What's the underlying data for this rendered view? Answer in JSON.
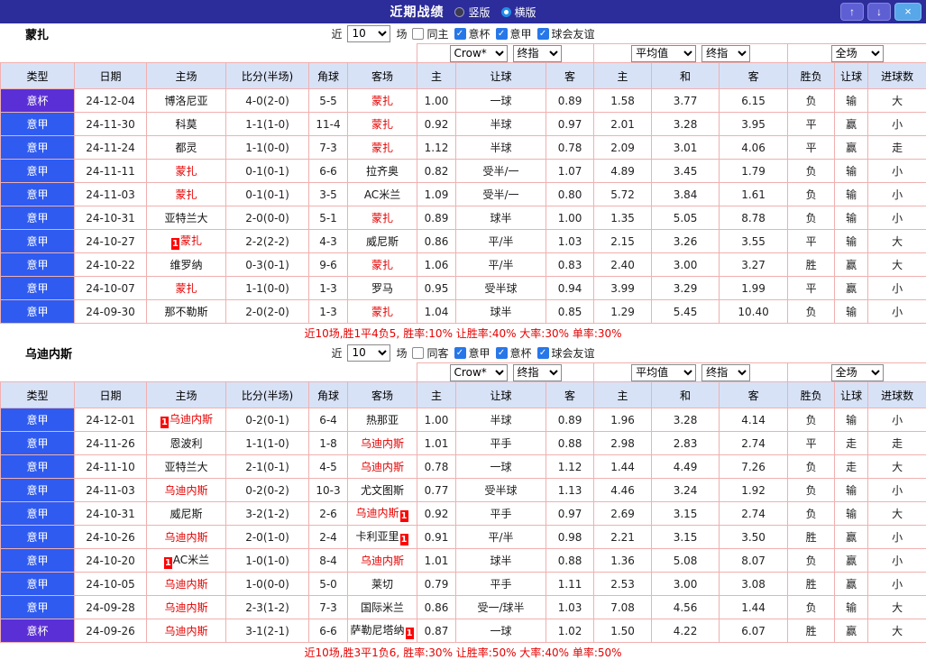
{
  "topbar": {
    "title": "近期战绩",
    "radio_vertical": "竖版",
    "radio_horizontal": "横版",
    "selected": "横版",
    "up_icon": "↑",
    "down_icon": "↓",
    "close_icon": "×"
  },
  "colors": {
    "topbar_bg": "#2c2c9a",
    "seriea_bg": "#2f5bf0",
    "cup_bg": "#5b2fd6",
    "win_red": "#e60000",
    "draw_green": "#009944",
    "lose_blue": "#2143de",
    "grid_line": "#f0b0b0",
    "header_bg": "#d8e2f6"
  },
  "table_headers": [
    "类型",
    "日期",
    "主场",
    "比分(半场)",
    "角球",
    "客场",
    "主",
    "让球",
    "客",
    "主",
    "和",
    "客",
    "胜负",
    "让球",
    "进球数"
  ],
  "sections": [
    {
      "team": "蒙扎",
      "near_label": "近",
      "near_count": "10",
      "games_label": "场",
      "checkboxes": [
        {
          "label": "同主",
          "checked": false
        },
        {
          "label": "意杯",
          "checked": true
        },
        {
          "label": "意甲",
          "checked": true
        },
        {
          "label": "球会友谊",
          "checked": true
        }
      ],
      "selects": {
        "bookmaker": "Crow*",
        "bookmaker_stat": "终指",
        "euro": "平均值",
        "euro_stat": "终指",
        "scope": "全场"
      },
      "rows": [
        {
          "lg": "c",
          "league": "意杯",
          "date": "24-12-04",
          "home": "博洛尼亚",
          "home_self": false,
          "home_card": "",
          "score": "4-0(2-0)",
          "corners": "5-5",
          "away": "蒙扎",
          "away_self": true,
          "away_card": "",
          "odds": [
            "1.00",
            "一球",
            "0.89"
          ],
          "euro": [
            "1.58",
            "3.77",
            "6.15"
          ],
          "wdl": "负",
          "wdl_c": "b",
          "hcp": "输",
          "hcp_c": "b",
          "ou": "大",
          "ou_c": "r"
        },
        {
          "lg": "a",
          "league": "意甲",
          "date": "24-11-30",
          "home": "科莫",
          "home_self": false,
          "home_card": "",
          "score": "1-1(1-0)",
          "corners": "11-4",
          "away": "蒙扎",
          "away_self": true,
          "away_card": "",
          "odds": [
            "0.92",
            "半球",
            "0.97"
          ],
          "euro": [
            "2.01",
            "3.28",
            "3.95"
          ],
          "wdl": "平",
          "wdl_c": "g",
          "hcp": "赢",
          "hcp_c": "r",
          "ou": "小",
          "ou_c": "b"
        },
        {
          "lg": "a",
          "league": "意甲",
          "date": "24-11-24",
          "home": "都灵",
          "home_self": false,
          "home_card": "",
          "score": "1-1(0-0)",
          "corners": "7-3",
          "away": "蒙扎",
          "away_self": true,
          "away_card": "",
          "odds": [
            "1.12",
            "半球",
            "0.78"
          ],
          "euro": [
            "2.09",
            "3.01",
            "4.06"
          ],
          "wdl": "平",
          "wdl_c": "g",
          "hcp": "赢",
          "hcp_c": "r",
          "ou": "走",
          "ou_c": "g"
        },
        {
          "lg": "a",
          "league": "意甲",
          "date": "24-11-11",
          "home": "蒙扎",
          "home_self": true,
          "home_card": "",
          "score": "0-1(0-1)",
          "corners": "6-6",
          "away": "拉齐奥",
          "away_self": false,
          "away_card": "",
          "odds": [
            "0.82",
            "受半/一",
            "1.07"
          ],
          "euro": [
            "4.89",
            "3.45",
            "1.79"
          ],
          "wdl": "负",
          "wdl_c": "b",
          "hcp": "输",
          "hcp_c": "b",
          "ou": "小",
          "ou_c": "b"
        },
        {
          "lg": "a",
          "league": "意甲",
          "date": "24-11-03",
          "home": "蒙扎",
          "home_self": true,
          "home_card": "",
          "score": "0-1(0-1)",
          "corners": "3-5",
          "away": "AC米兰",
          "away_self": false,
          "away_card": "",
          "odds": [
            "1.09",
            "受半/一",
            "0.80"
          ],
          "euro": [
            "5.72",
            "3.84",
            "1.61"
          ],
          "wdl": "负",
          "wdl_c": "b",
          "hcp": "输",
          "hcp_c": "b",
          "ou": "小",
          "ou_c": "b"
        },
        {
          "lg": "a",
          "league": "意甲",
          "date": "24-10-31",
          "home": "亚特兰大",
          "home_self": false,
          "home_card": "",
          "score": "2-0(0-0)",
          "corners": "5-1",
          "away": "蒙扎",
          "away_self": true,
          "away_card": "",
          "odds": [
            "0.89",
            "球半",
            "1.00"
          ],
          "euro": [
            "1.35",
            "5.05",
            "8.78"
          ],
          "wdl": "负",
          "wdl_c": "b",
          "hcp": "输",
          "hcp_c": "b",
          "ou": "小",
          "ou_c": "b"
        },
        {
          "lg": "a",
          "league": "意甲",
          "date": "24-10-27",
          "home": "蒙扎",
          "home_self": true,
          "home_card": "1",
          "home_card_pos": "before",
          "score": "2-2(2-2)",
          "corners": "4-3",
          "away": "威尼斯",
          "away_self": false,
          "away_card": "",
          "odds": [
            "0.86",
            "平/半",
            "1.03"
          ],
          "euro": [
            "2.15",
            "3.26",
            "3.55"
          ],
          "wdl": "平",
          "wdl_c": "g",
          "hcp": "输",
          "hcp_c": "b",
          "ou": "大",
          "ou_c": "r"
        },
        {
          "lg": "a",
          "league": "意甲",
          "date": "24-10-22",
          "home": "维罗纳",
          "home_self": false,
          "home_card": "",
          "score": "0-3(0-1)",
          "corners": "9-6",
          "away": "蒙扎",
          "away_self": true,
          "away_card": "",
          "odds": [
            "1.06",
            "平/半",
            "0.83"
          ],
          "euro": [
            "2.40",
            "3.00",
            "3.27"
          ],
          "wdl": "胜",
          "wdl_c": "r",
          "hcp": "赢",
          "hcp_c": "r",
          "ou": "大",
          "ou_c": "r"
        },
        {
          "lg": "a",
          "league": "意甲",
          "date": "24-10-07",
          "home": "蒙扎",
          "home_self": true,
          "home_card": "",
          "score": "1-1(0-0)",
          "corners": "1-3",
          "away": "罗马",
          "away_self": false,
          "away_card": "",
          "odds": [
            "0.95",
            "受半球",
            "0.94"
          ],
          "euro": [
            "3.99",
            "3.29",
            "1.99"
          ],
          "wdl": "平",
          "wdl_c": "g",
          "hcp": "赢",
          "hcp_c": "r",
          "ou": "小",
          "ou_c": "b"
        },
        {
          "lg": "a",
          "league": "意甲",
          "date": "24-09-30",
          "home": "那不勒斯",
          "home_self": false,
          "home_card": "",
          "score": "2-0(2-0)",
          "corners": "1-3",
          "away": "蒙扎",
          "away_self": true,
          "away_card": "",
          "odds": [
            "1.04",
            "球半",
            "0.85"
          ],
          "euro": [
            "1.29",
            "5.45",
            "10.40"
          ],
          "wdl": "负",
          "wdl_c": "b",
          "hcp": "输",
          "hcp_c": "b",
          "ou": "小",
          "ou_c": "b"
        }
      ],
      "footer_summary": "近10场,胜1平4负5,",
      "footer_stats": "胜率:10% 让胜率:40% 大率:30% 单率:30%"
    },
    {
      "team": "乌迪内斯",
      "near_label": "近",
      "near_count": "10",
      "games_label": "场",
      "checkboxes": [
        {
          "label": "同客",
          "checked": false
        },
        {
          "label": "意甲",
          "checked": true
        },
        {
          "label": "意杯",
          "checked": true
        },
        {
          "label": "球会友谊",
          "checked": true
        }
      ],
      "selects": {
        "bookmaker": "Crow*",
        "bookmaker_stat": "终指",
        "euro": "平均值",
        "euro_stat": "终指",
        "scope": "全场"
      },
      "rows": [
        {
          "lg": "a",
          "league": "意甲",
          "date": "24-12-01",
          "home": "乌迪内斯",
          "home_self": true,
          "home_card": "1",
          "home_card_pos": "before",
          "score": "0-2(0-1)",
          "corners": "6-4",
          "away": "热那亚",
          "away_self": false,
          "away_card": "",
          "odds": [
            "1.00",
            "半球",
            "0.89"
          ],
          "euro": [
            "1.96",
            "3.28",
            "4.14"
          ],
          "wdl": "负",
          "wdl_c": "b",
          "hcp": "输",
          "hcp_c": "b",
          "ou": "小",
          "ou_c": "b"
        },
        {
          "lg": "a",
          "league": "意甲",
          "date": "24-11-26",
          "home": "恩波利",
          "home_self": false,
          "home_card": "",
          "score": "1-1(1-0)",
          "corners": "1-8",
          "away": "乌迪内斯",
          "away_self": true,
          "away_card": "",
          "odds": [
            "1.01",
            "平手",
            "0.88"
          ],
          "euro": [
            "2.98",
            "2.83",
            "2.74"
          ],
          "wdl": "平",
          "wdl_c": "g",
          "hcp": "走",
          "hcp_c": "g",
          "ou": "走",
          "ou_c": "g"
        },
        {
          "lg": "a",
          "league": "意甲",
          "date": "24-11-10",
          "home": "亚特兰大",
          "home_self": false,
          "home_card": "",
          "score": "2-1(0-1)",
          "corners": "4-5",
          "away": "乌迪内斯",
          "away_self": true,
          "away_card": "",
          "odds": [
            "0.78",
            "一球",
            "1.12"
          ],
          "euro": [
            "1.44",
            "4.49",
            "7.26"
          ],
          "wdl": "负",
          "wdl_c": "b",
          "hcp": "走",
          "hcp_c": "g",
          "ou": "大",
          "ou_c": "r"
        },
        {
          "lg": "a",
          "league": "意甲",
          "date": "24-11-03",
          "home": "乌迪内斯",
          "home_self": true,
          "home_card": "",
          "score": "0-2(0-2)",
          "corners": "10-3",
          "away": "尤文图斯",
          "away_self": false,
          "away_card": "",
          "odds": [
            "0.77",
            "受半球",
            "1.13"
          ],
          "euro": [
            "4.46",
            "3.24",
            "1.92"
          ],
          "wdl": "负",
          "wdl_c": "b",
          "hcp": "输",
          "hcp_c": "b",
          "ou": "小",
          "ou_c": "b"
        },
        {
          "lg": "a",
          "league": "意甲",
          "date": "24-10-31",
          "home": "威尼斯",
          "home_self": false,
          "home_card": "",
          "score": "3-2(1-2)",
          "corners": "2-6",
          "away": "乌迪内斯",
          "away_self": true,
          "away_card": "1",
          "away_card_pos": "after",
          "odds": [
            "0.92",
            "平手",
            "0.97"
          ],
          "euro": [
            "2.69",
            "3.15",
            "2.74"
          ],
          "wdl": "负",
          "wdl_c": "b",
          "hcp": "输",
          "hcp_c": "b",
          "ou": "大",
          "ou_c": "r"
        },
        {
          "lg": "a",
          "league": "意甲",
          "date": "24-10-26",
          "home": "乌迪内斯",
          "home_self": true,
          "home_card": "",
          "score": "2-0(1-0)",
          "corners": "2-4",
          "away": "卡利亚里",
          "away_self": false,
          "away_card": "1",
          "away_card_pos": "after",
          "odds": [
            "0.91",
            "平/半",
            "0.98"
          ],
          "euro": [
            "2.21",
            "3.15",
            "3.50"
          ],
          "wdl": "胜",
          "wdl_c": "r",
          "hcp": "赢",
          "hcp_c": "r",
          "ou": "小",
          "ou_c": "b"
        },
        {
          "lg": "a",
          "league": "意甲",
          "date": "24-10-20",
          "home": "AC米兰",
          "home_self": false,
          "home_card": "1",
          "home_card_pos": "before",
          "score": "1-0(1-0)",
          "corners": "8-4",
          "away": "乌迪内斯",
          "away_self": true,
          "away_card": "",
          "odds": [
            "1.01",
            "球半",
            "0.88"
          ],
          "euro": [
            "1.36",
            "5.08",
            "8.07"
          ],
          "wdl": "负",
          "wdl_c": "b",
          "hcp": "赢",
          "hcp_c": "r",
          "ou": "小",
          "ou_c": "b"
        },
        {
          "lg": "a",
          "league": "意甲",
          "date": "24-10-05",
          "home": "乌迪内斯",
          "home_self": true,
          "home_card": "",
          "score": "1-0(0-0)",
          "corners": "5-0",
          "away": "莱切",
          "away_self": false,
          "away_card": "",
          "odds": [
            "0.79",
            "平手",
            "1.11"
          ],
          "euro": [
            "2.53",
            "3.00",
            "3.08"
          ],
          "wdl": "胜",
          "wdl_c": "r",
          "hcp": "赢",
          "hcp_c": "r",
          "ou": "小",
          "ou_c": "b"
        },
        {
          "lg": "a",
          "league": "意甲",
          "date": "24-09-28",
          "home": "乌迪内斯",
          "home_self": true,
          "home_card": "",
          "score": "2-3(1-2)",
          "corners": "7-3",
          "away": "国际米兰",
          "away_self": false,
          "away_card": "",
          "odds": [
            "0.86",
            "受一/球半",
            "1.03"
          ],
          "euro": [
            "7.08",
            "4.56",
            "1.44"
          ],
          "wdl": "负",
          "wdl_c": "b",
          "hcp": "输",
          "hcp_c": "b",
          "ou": "大",
          "ou_c": "r"
        },
        {
          "lg": "c",
          "league": "意杯",
          "date": "24-09-26",
          "home": "乌迪内斯",
          "home_self": true,
          "home_card": "",
          "score": "3-1(2-1)",
          "corners": "6-6",
          "away": "萨勒尼塔纳",
          "away_self": false,
          "away_card": "1",
          "away_card_pos": "after",
          "odds": [
            "0.87",
            "一球",
            "1.02"
          ],
          "euro": [
            "1.50",
            "4.22",
            "6.07"
          ],
          "wdl": "胜",
          "wdl_c": "r",
          "hcp": "赢",
          "hcp_c": "r",
          "ou": "大",
          "ou_c": "r"
        }
      ],
      "footer_summary": "近10场,胜3平1负6,",
      "footer_stats": "胜率:30% 让胜率:50% 大率:40% 单率:50%"
    }
  ]
}
